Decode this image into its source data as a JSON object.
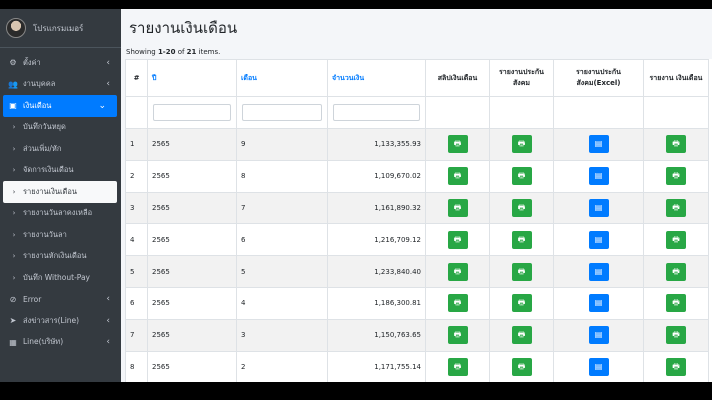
{
  "user": {
    "name": "โปรแกรมเมอร์"
  },
  "sidebar": {
    "items": [
      {
        "icon": "⚙",
        "label": "ตั้งค่า",
        "caret": "‹",
        "type": "top"
      },
      {
        "icon": "👥",
        "label": "งานบุคคล",
        "caret": "‹",
        "type": "top"
      },
      {
        "icon": "▣",
        "label": "เงินเดือน",
        "caret": "⌄",
        "type": "active"
      },
      {
        "icon": "›",
        "label": "บันทึกวันหยุด",
        "type": "sub"
      },
      {
        "icon": "›",
        "label": "ส่วนเพิ่ม/หัก",
        "type": "sub"
      },
      {
        "icon": "›",
        "label": "จัดการเงินเดือน",
        "type": "sub"
      },
      {
        "icon": "›",
        "label": "รายงานเงินเดือน",
        "type": "current"
      },
      {
        "icon": "›",
        "label": "รายงานวันลาคงเหลือ",
        "type": "sub"
      },
      {
        "icon": "›",
        "label": "รายงานวันลา",
        "type": "sub"
      },
      {
        "icon": "›",
        "label": "รายงานหักเงินเดือน",
        "type": "sub"
      },
      {
        "icon": "›",
        "label": "บันทึก Without-Pay",
        "type": "sub"
      },
      {
        "icon": "⊘",
        "label": "Error",
        "caret": "‹",
        "type": "top"
      },
      {
        "icon": "➤",
        "label": "ส่งข่าวสาร(Line)",
        "caret": "‹",
        "type": "top"
      },
      {
        "icon": "▦",
        "label": "Line(บริษัท)",
        "caret": "‹",
        "type": "top"
      }
    ]
  },
  "page": {
    "title": "รายงานเงินเดือน",
    "summary_prefix": "Showing ",
    "summary_range": "1-20",
    "summary_mid": " of ",
    "summary_total": "21",
    "summary_suffix": " items."
  },
  "table": {
    "headers": {
      "index": "#",
      "year": "ปี",
      "month": "เดือน",
      "amount": "จำนวนเงิน",
      "slip": "สลิปเงินเดือน",
      "social": "รายงานประกัน สังคม",
      "social_excel": "รายงานประกัน สังคม(Excel)",
      "salary_report": "รายงาน เงินเดือน"
    },
    "rows": [
      {
        "index": "1",
        "year": "2565",
        "month": "9",
        "amount": "1,133,355.93"
      },
      {
        "index": "2",
        "year": "2565",
        "month": "8",
        "amount": "1,109,670.02"
      },
      {
        "index": "3",
        "year": "2565",
        "month": "7",
        "amount": "1,161,890.32"
      },
      {
        "index": "4",
        "year": "2565",
        "month": "6",
        "amount": "1,216,709.12"
      },
      {
        "index": "5",
        "year": "2565",
        "month": "5",
        "amount": "1,233,840.40"
      },
      {
        "index": "6",
        "year": "2565",
        "month": "4",
        "amount": "1,186,300.81"
      },
      {
        "index": "7",
        "year": "2565",
        "month": "3",
        "amount": "1,150,763.65"
      },
      {
        "index": "8",
        "year": "2565",
        "month": "2",
        "amount": "1,171,755.14"
      }
    ]
  },
  "icons": {
    "print": "print-icon",
    "excel": "file-excel-icon"
  },
  "colors": {
    "sidebar": "#343a40",
    "active": "#007bff",
    "green": "#28a745",
    "blue": "#007bff"
  }
}
